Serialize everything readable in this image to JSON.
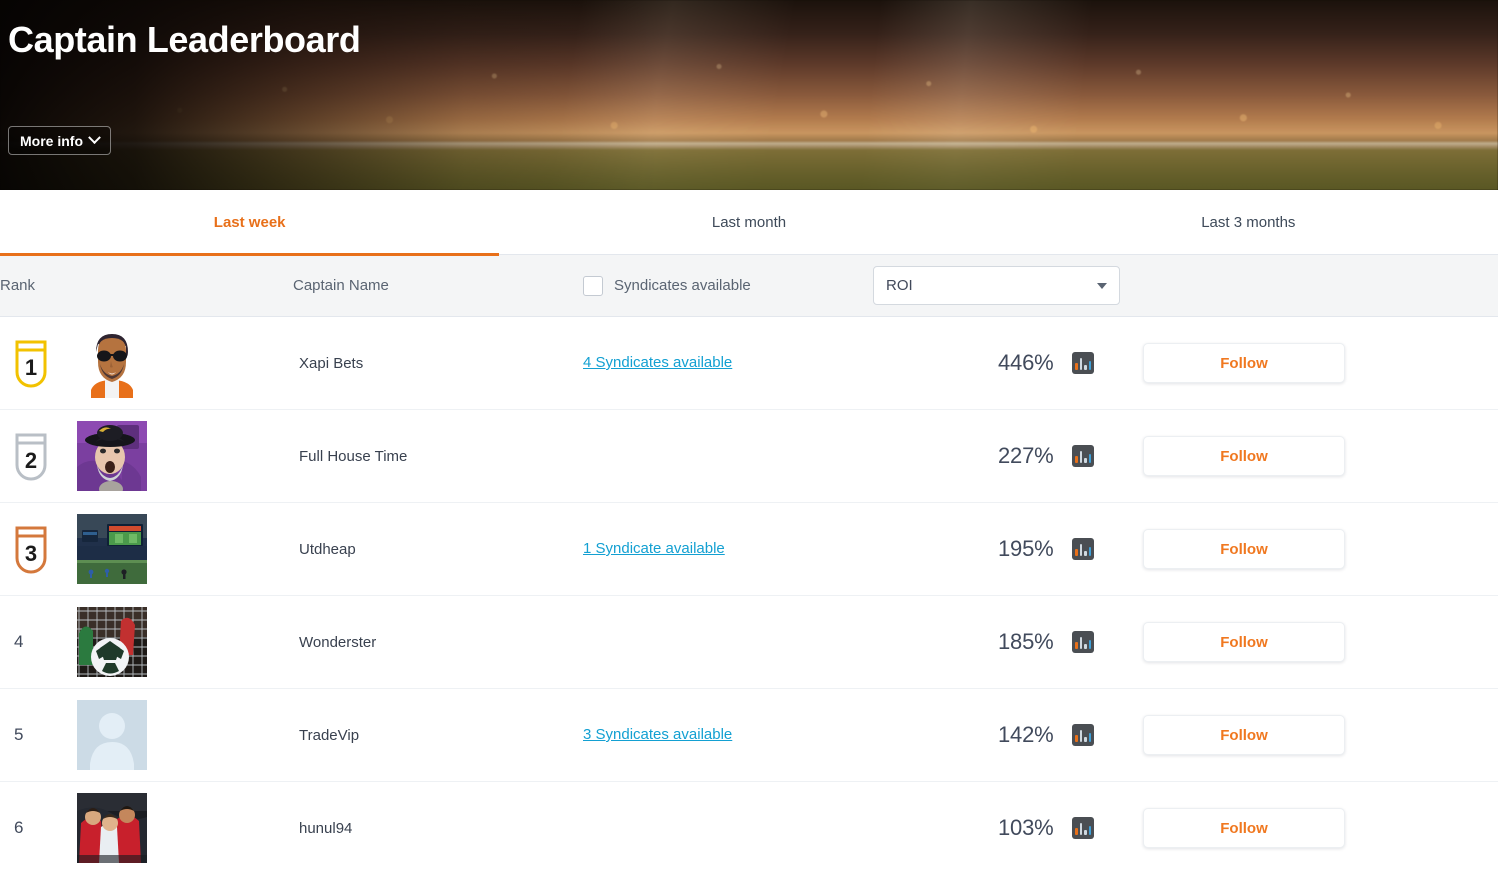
{
  "hero": {
    "title": "Captain Leaderboard",
    "more_info_label": "More info",
    "chevron_icon": "chevron-down-icon"
  },
  "tabs": [
    {
      "label": "Last week",
      "active": true
    },
    {
      "label": "Last month",
      "active": false
    },
    {
      "label": "Last 3 months",
      "active": false
    }
  ],
  "table_header": {
    "rank": "Rank",
    "captain_name": "Captain Name",
    "syndicates_checkbox_label": "Syndicates available",
    "syndicates_checked": false,
    "sort_select_value": "ROI",
    "sort_select_options": [
      "ROI"
    ]
  },
  "colors": {
    "accent_orange": "#e8701a",
    "follow_orange": "#f07820",
    "link_blue": "#13a0d2",
    "text_dark": "#39414f",
    "gold": "#f2c200",
    "silver": "#b9bfc6",
    "bronze": "#d4783c"
  },
  "rows": [
    {
      "rank": "1",
      "medal": "gold",
      "avatar": "illustrated-man-sunglasses",
      "name": "Xapi Bets",
      "syndicates": "4 Syndicates available",
      "roi": "446%",
      "chart_icon": "bar-chart-icon",
      "follow_label": "Follow"
    },
    {
      "rank": "2",
      "medal": "silver",
      "avatar": "fan-in-purple-hat",
      "name": "Full House Time",
      "syndicates": "",
      "roi": "227%",
      "chart_icon": "bar-chart-icon",
      "follow_label": "Follow"
    },
    {
      "rank": "3",
      "medal": "bronze",
      "avatar": "stadium-big-screen",
      "name": "Utdheap",
      "syndicates": "1 Syndicate available",
      "roi": "195%",
      "chart_icon": "bar-chart-icon",
      "follow_label": "Follow"
    },
    {
      "rank": "4",
      "medal": "",
      "avatar": "ball-in-net",
      "name": "Wonderster",
      "syndicates": "",
      "roi": "185%",
      "chart_icon": "bar-chart-icon",
      "follow_label": "Follow"
    },
    {
      "rank": "5",
      "medal": "",
      "avatar": "default-person-placeholder",
      "name": "TradeVip",
      "syndicates": "3 Syndicates available",
      "roi": "142%",
      "chart_icon": "bar-chart-icon",
      "follow_label": "Follow"
    },
    {
      "rank": "6",
      "medal": "",
      "avatar": "players-celebrating",
      "name": "hunul94",
      "syndicates": "",
      "roi": "103%",
      "chart_icon": "bar-chart-icon",
      "follow_label": "Follow"
    }
  ]
}
